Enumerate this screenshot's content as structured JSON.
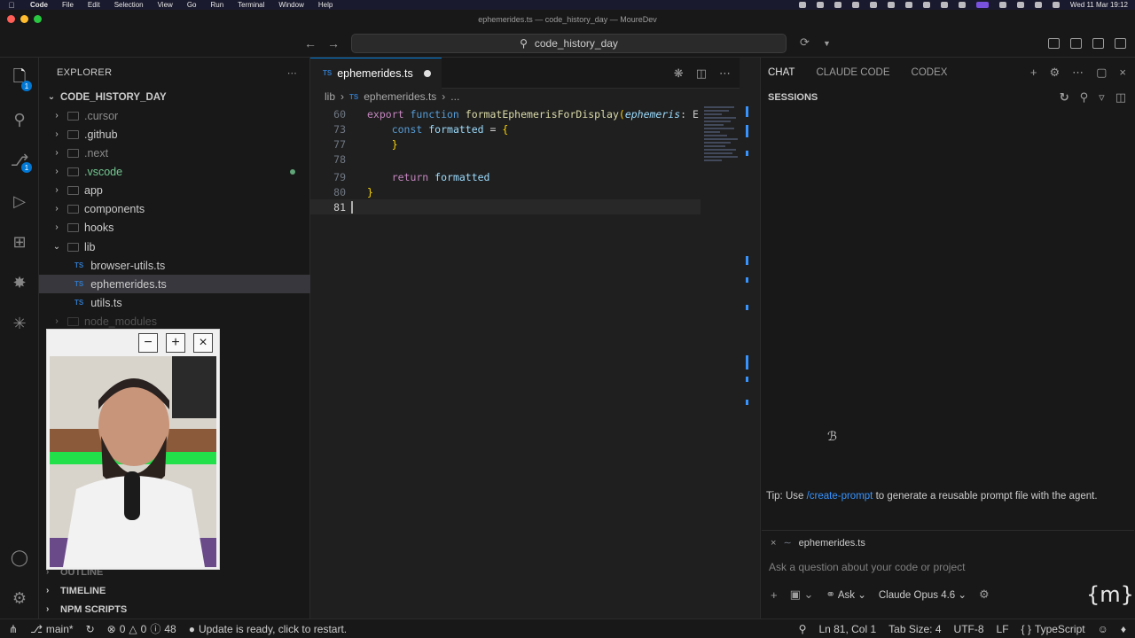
{
  "menubar": {
    "app": "Code",
    "items": [
      "File",
      "Edit",
      "Selection",
      "View",
      "Go",
      "Run",
      "Terminal",
      "Window",
      "Help"
    ],
    "datetime": "Wed 11 Mar 19:12"
  },
  "window": {
    "title": "ephemerides.ts — code_history_day — MoureDev"
  },
  "command_center": {
    "search_label": "code_history_day"
  },
  "activity_bar": {
    "explorer_badge": "1",
    "scm_badge": "1"
  },
  "explorer": {
    "header": "EXPLORER",
    "root": "CODE_HISTORY_DAY",
    "items": [
      {
        "label": ".cursor",
        "kind": "folder"
      },
      {
        "label": ".github",
        "kind": "folder"
      },
      {
        "label": ".next",
        "kind": "folder"
      },
      {
        "label": ".vscode",
        "kind": "folder"
      },
      {
        "label": "app",
        "kind": "folder"
      },
      {
        "label": "components",
        "kind": "folder"
      },
      {
        "label": "hooks",
        "kind": "folder"
      },
      {
        "label": "lib",
        "kind": "folder-open"
      },
      {
        "label": "browser-utils.ts",
        "kind": "ts"
      },
      {
        "label": "ephemerides.ts",
        "kind": "ts"
      },
      {
        "label": "utils.ts",
        "kind": "ts"
      },
      {
        "label": "node_modules",
        "kind": "folder"
      }
    ],
    "sections": [
      "OUTLINE",
      "TIMELINE",
      "NPM SCRIPTS"
    ],
    "ts_glyph": "TS"
  },
  "editor": {
    "tab_label": "ephemerides.ts",
    "breadcrumb": [
      "lib",
      "ephemerides.ts",
      "..."
    ],
    "lines": [
      {
        "n": "60",
        "t1": "export ",
        "t2": "function ",
        "t3": "formatEphemerisForDisplay",
        "t4": "(",
        "t5": "ephemeris",
        "t6": ": E"
      },
      {
        "n": "73",
        "t1": "    const ",
        "t2": "formatted",
        "t3": " = ",
        "t4": "{"
      },
      {
        "n": "77",
        "t1": "    }"
      },
      {
        "n": "78"
      },
      {
        "n": "79",
        "t1": "    return ",
        "t2": "formatted"
      },
      {
        "n": "80",
        "t1": "}"
      },
      {
        "n": "81"
      }
    ]
  },
  "chat": {
    "tabs": [
      "CHAT",
      "CLAUDE CODE",
      "CODEX"
    ],
    "sessions_header": "SESSIONS",
    "tip_prefix": "Tip: Use ",
    "tip_link": "/create-prompt",
    "tip_suffix": " to generate a reusable prompt file with the agent.",
    "context_file": "ephemerides.ts",
    "input_placeholder": "Ask a question about your code or project",
    "mode": "Ask",
    "model": "Claude Opus 4.6",
    "brand": "{m}"
  },
  "statusbar": {
    "branch": "main*",
    "errors": "0",
    "warnings": "0",
    "info": "48",
    "update": "Update is ready, click to restart.",
    "position": "Ln 81, Col 1",
    "tab_size": "Tab Size: 4",
    "encoding": "UTF-8",
    "eol": "LF",
    "language": "TypeScript",
    "language_braces": "{ }"
  },
  "colors": {
    "accent": "#0078d4",
    "git_added": "#73c991",
    "ts_blue": "#3178c6"
  }
}
